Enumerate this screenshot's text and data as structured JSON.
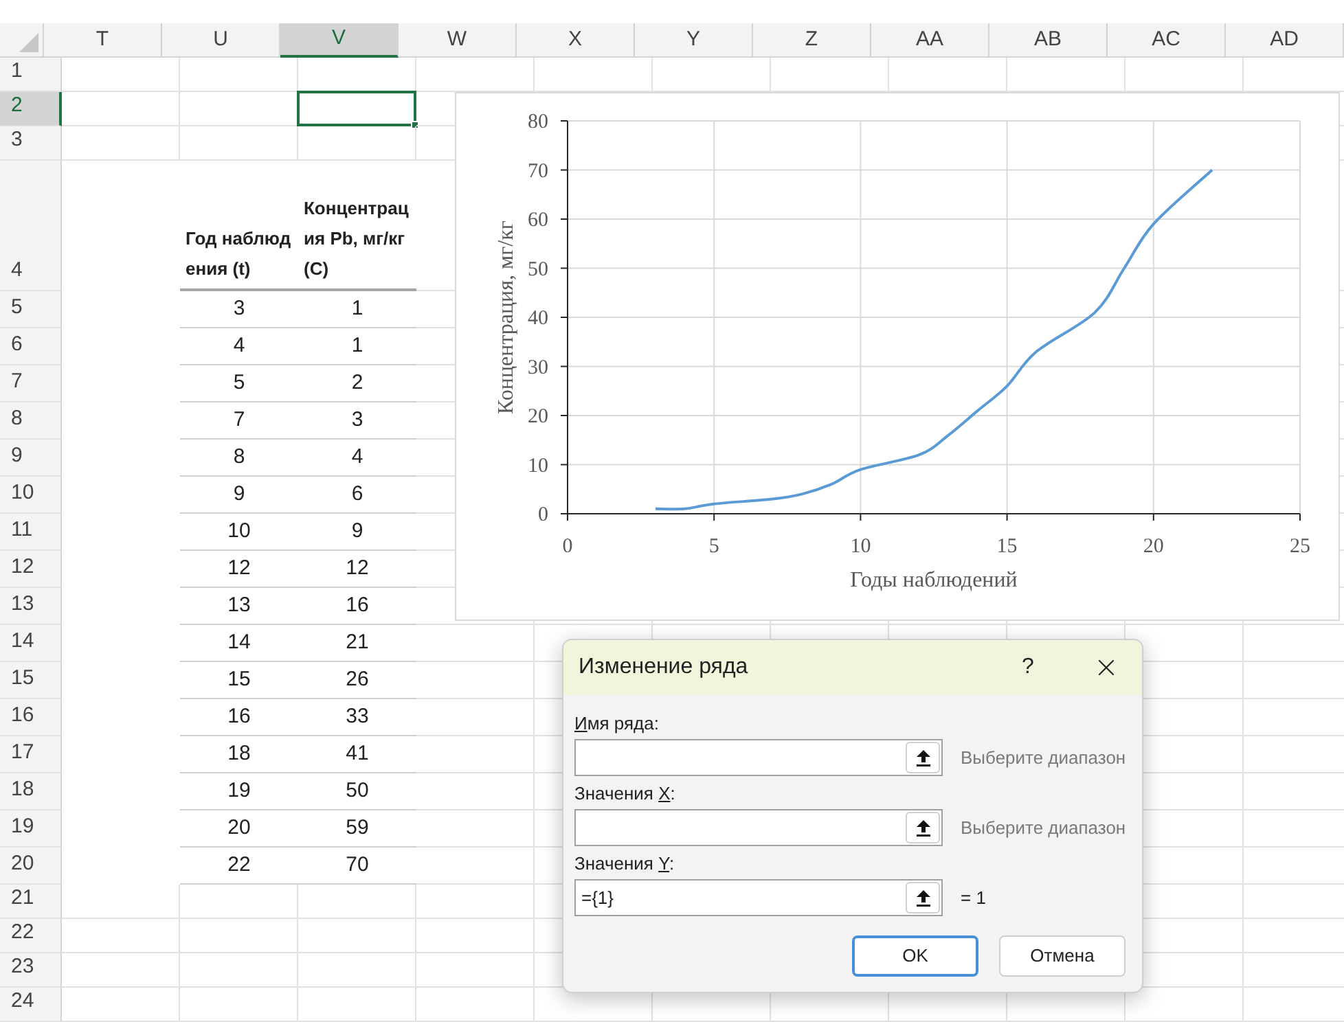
{
  "sheet": {
    "columns": [
      {
        "label": "T",
        "selected": false
      },
      {
        "label": "U",
        "selected": false
      },
      {
        "label": "V",
        "selected": true
      },
      {
        "label": "W",
        "selected": false
      },
      {
        "label": "X",
        "selected": false
      },
      {
        "label": "Y",
        "selected": false
      },
      {
        "label": "Z",
        "selected": false
      },
      {
        "label": "AA",
        "selected": false
      },
      {
        "label": "AB",
        "selected": false
      },
      {
        "label": "AC",
        "selected": false
      },
      {
        "label": "AD",
        "selected": false
      }
    ],
    "rows": [
      {
        "label": "1",
        "selected": false
      },
      {
        "label": "2",
        "selected": true
      },
      {
        "label": "3",
        "selected": false
      },
      {
        "label": "4",
        "selected": false
      },
      {
        "label": "5",
        "selected": false
      },
      {
        "label": "6",
        "selected": false
      },
      {
        "label": "7",
        "selected": false
      },
      {
        "label": "8",
        "selected": false
      },
      {
        "label": "9",
        "selected": false
      },
      {
        "label": "10",
        "selected": false
      },
      {
        "label": "11",
        "selected": false
      },
      {
        "label": "12",
        "selected": false
      },
      {
        "label": "13",
        "selected": false
      },
      {
        "label": "14",
        "selected": false
      },
      {
        "label": "15",
        "selected": false
      },
      {
        "label": "16",
        "selected": false
      },
      {
        "label": "17",
        "selected": false
      },
      {
        "label": "18",
        "selected": false
      },
      {
        "label": "19",
        "selected": false
      },
      {
        "label": "20",
        "selected": false
      },
      {
        "label": "21",
        "selected": false
      },
      {
        "label": "22",
        "selected": false
      },
      {
        "label": "23",
        "selected": false
      },
      {
        "label": "24",
        "selected": false
      }
    ],
    "table": {
      "columns": [
        "Год наблюдения (t)",
        "Концентрация Pb, мг/кг (C)"
      ],
      "rows": [
        [
          "3",
          "1"
        ],
        [
          "4",
          "1"
        ],
        [
          "5",
          "2"
        ],
        [
          "7",
          "3"
        ],
        [
          "8",
          "4"
        ],
        [
          "9",
          "6"
        ],
        [
          "10",
          "9"
        ],
        [
          "12",
          "12"
        ],
        [
          "13",
          "16"
        ],
        [
          "14",
          "21"
        ],
        [
          "15",
          "26"
        ],
        [
          "16",
          "33"
        ],
        [
          "18",
          "41"
        ],
        [
          "19",
          "50"
        ],
        [
          "20",
          "59"
        ],
        [
          "22",
          "70"
        ]
      ]
    }
  },
  "chart": {
    "chart_data": {
      "type": "line",
      "xlabel": "Годы наблюдений",
      "ylabel": "Концентрация, мг/кг",
      "x": [
        3,
        4,
        5,
        7,
        8,
        9,
        10,
        12,
        13,
        14,
        15,
        16,
        18,
        19,
        20,
        22
      ],
      "grid": true,
      "series": [
        {
          "color": "#5b9bd5",
          "values": [
            1,
            1,
            2,
            3,
            4,
            6,
            9,
            12,
            16,
            21,
            26,
            33,
            41,
            50,
            59,
            70
          ]
        }
      ],
      "xlim": [
        0,
        25
      ],
      "ylim": [
        0,
        80
      ],
      "xticks": [
        0,
        5,
        10,
        15,
        20,
        25
      ],
      "yticks": [
        0,
        10,
        20,
        30,
        40,
        50,
        60,
        70,
        80
      ]
    }
  },
  "dialog": {
    "title": "Изменение ряда",
    "help": "?",
    "fields": [
      {
        "label_parts": [
          {
            "text": "И",
            "underlined": true
          },
          {
            "text": "мя ряда:",
            "underlined": false
          }
        ],
        "note": "Выберите диапазон",
        "note_dimmed": true
      },
      {
        "label_parts": [
          {
            "text": "Значения ",
            "underlined": false
          },
          {
            "text": "X",
            "underlined": true
          },
          {
            "text": ":",
            "underlined": false
          }
        ],
        "note": "Выберите диапазон",
        "note_dimmed": true
      },
      {
        "label_parts": [
          {
            "text": "Значения ",
            "underlined": false
          },
          {
            "text": "Y",
            "underlined": true
          },
          {
            "text": ":",
            "underlined": false
          }
        ],
        "value": "={1}",
        "note": "= 1",
        "note_dimmed": false
      }
    ],
    "buttons": [
      {
        "label": "OK",
        "default": true
      },
      {
        "label": "Отмена",
        "default": false
      }
    ]
  }
}
